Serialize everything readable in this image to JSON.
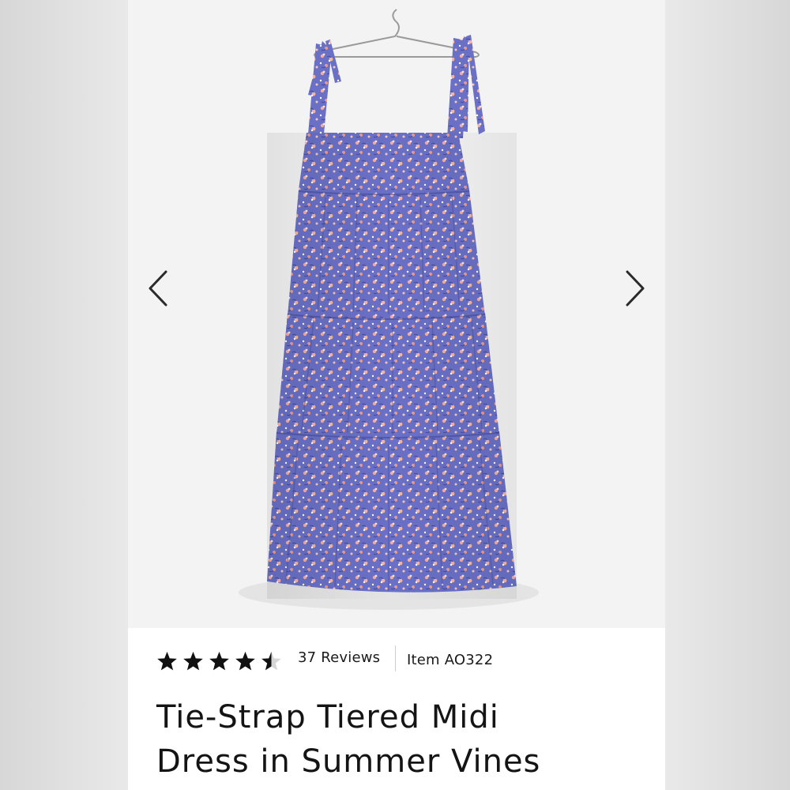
{
  "product": {
    "title_line1": "Tie-Strap Tiered Midi",
    "title_line2": "Dress in Summer Vines",
    "rating_stars": 4.5,
    "rating_max": 5,
    "reviews_label": "37 Reviews",
    "item_label": "Item AO322"
  },
  "gallery": {
    "image_alt": "Tie-strap tiered midi dress in blue floral print on hanger",
    "prev_icon": "chevron-left-icon",
    "next_icon": "chevron-right-icon"
  },
  "colors": {
    "dress_blue": "#6b73c9",
    "print_pink": "#f1a99a",
    "text": "#141414"
  }
}
